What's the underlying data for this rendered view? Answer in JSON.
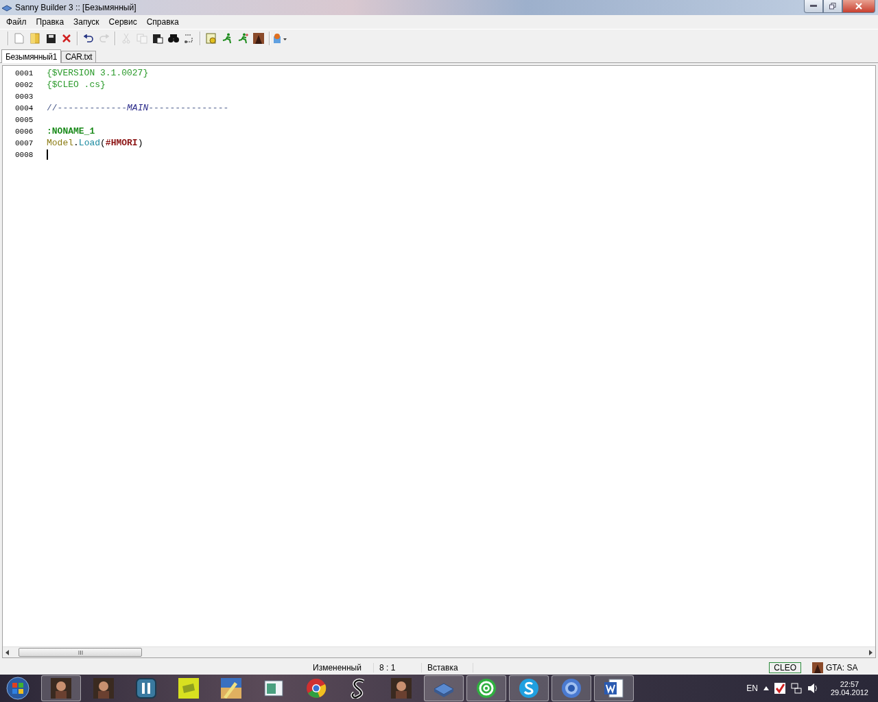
{
  "window": {
    "title": "Sanny Builder 3 :: [Безымянный]"
  },
  "menu": [
    "Файл",
    "Правка",
    "Запуск",
    "Сервис",
    "Справка"
  ],
  "toolbar": [
    {
      "kind": "new",
      "disabled": false
    },
    {
      "kind": "open",
      "disabled": false
    },
    {
      "kind": "save",
      "disabled": false
    },
    {
      "kind": "close",
      "disabled": false
    },
    {
      "kind": "separator"
    },
    {
      "kind": "undo",
      "disabled": false
    },
    {
      "kind": "redo",
      "disabled": true
    },
    {
      "kind": "separator"
    },
    {
      "kind": "cut",
      "disabled": true
    },
    {
      "kind": "copy",
      "disabled": true
    },
    {
      "kind": "paste",
      "disabled": false
    },
    {
      "kind": "find",
      "disabled": false
    },
    {
      "kind": "replace",
      "disabled": false
    },
    {
      "kind": "separator"
    },
    {
      "kind": "compile",
      "disabled": false
    },
    {
      "kind": "run",
      "disabled": false
    },
    {
      "kind": "run-test",
      "disabled": false
    },
    {
      "kind": "game",
      "disabled": false
    },
    {
      "kind": "separator"
    },
    {
      "kind": "tools",
      "disabled": false
    }
  ],
  "tabs": [
    {
      "label": "Безымянный1",
      "selected": true
    },
    {
      "label": "CAR.txt",
      "selected": false
    }
  ],
  "editor": {
    "lines": [
      {
        "number": "0001",
        "caret": false,
        "tokens": [
          {
            "kind": "directive",
            "text": "{$VERSION 3.1.0027}"
          }
        ]
      },
      {
        "number": "0002",
        "caret": false,
        "tokens": [
          {
            "kind": "directive",
            "text": "{$CLEO .cs}"
          }
        ]
      },
      {
        "number": "0003",
        "caret": false
      },
      {
        "number": "0004",
        "caret": false,
        "tokens": [
          {
            "kind": "comment",
            "text": "//-------------"
          },
          {
            "kind": "comment-keyword",
            "text": "MAIN"
          },
          {
            "kind": "comment",
            "text": "---------------"
          }
        ]
      },
      {
        "number": "0005",
        "caret": false
      },
      {
        "number": "0006",
        "caret": false,
        "tokens": [
          {
            "kind": "label",
            "text": ":NONAME_1"
          }
        ]
      },
      {
        "number": "0007",
        "caret": false,
        "tokens": [
          {
            "kind": "class",
            "text": "Model"
          },
          {
            "kind": "punct",
            "text": "."
          },
          {
            "kind": "method",
            "text": "Load"
          },
          {
            "kind": "punct",
            "text": "("
          },
          {
            "kind": "model",
            "text": "#HMORI"
          },
          {
            "kind": "punct",
            "text": ")"
          }
        ]
      },
      {
        "number": "0008",
        "caret": true
      }
    ]
  },
  "status_bar": {
    "state": "Измененный",
    "position": "8 : 1",
    "mode": "Вставка",
    "compiler": "CLEO",
    "game": "GTA: SA"
  },
  "taskbar": {
    "items": [
      {
        "kind": "portrait",
        "selected": true
      },
      {
        "kind": "portrait",
        "selected": false
      },
      {
        "kind": "twin-bars",
        "selected": false
      },
      {
        "kind": "sticker",
        "selected": false
      },
      {
        "kind": "brush",
        "selected": false
      },
      {
        "kind": "window",
        "selected": false
      },
      {
        "kind": "chrome",
        "selected": false
      },
      {
        "kind": "swirl",
        "selected": false
      },
      {
        "kind": "portrait",
        "selected": false
      },
      {
        "kind": "builder",
        "selected": true
      },
      {
        "kind": "at",
        "selected": true
      },
      {
        "kind": "skype",
        "selected": true
      },
      {
        "kind": "chromium",
        "selected": true
      },
      {
        "kind": "word",
        "selected": true
      }
    ],
    "language": "EN",
    "time": "22:57",
    "date": "29.04.2012"
  }
}
